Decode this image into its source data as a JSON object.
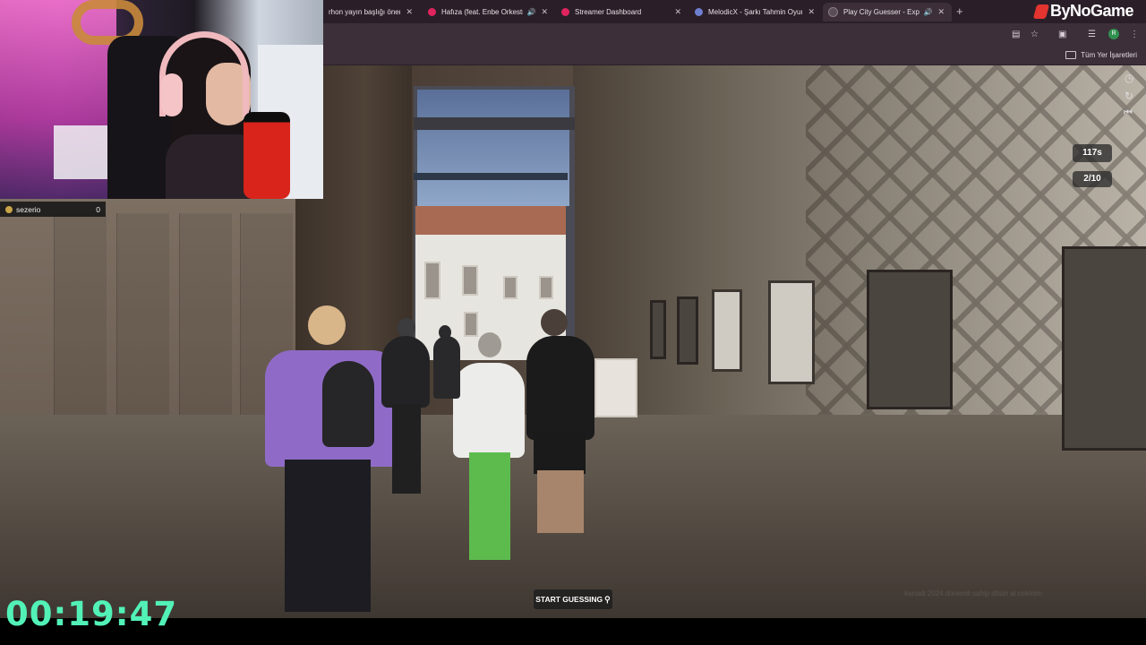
{
  "browser": {
    "tabs": [
      {
        "title": "rhon yayın başlığı öneri",
        "favicon_color": "#4a6fa5",
        "audio": false,
        "active": false
      },
      {
        "title": "Hafıza (feat. Enbe Orkestras",
        "favicon_color": "#e0245e",
        "audio": true,
        "active": false
      },
      {
        "title": "Streamer Dashboard",
        "favicon_color": "#e0245e",
        "audio": false,
        "active": false
      },
      {
        "title": "MelodicX - Şarkı Tahmin Oyunu",
        "favicon_color": "#6e7fd1",
        "audio": false,
        "active": false
      },
      {
        "title": "Play City Guesser - Explore",
        "favicon_color": "#5a4d58",
        "audio": true,
        "active": true
      }
    ],
    "new_tab": "+",
    "bookmarks_label": "Tüm Yer İşaretleri",
    "profile_initial": "R"
  },
  "game": {
    "timer_remaining": "117s",
    "round": "2/10",
    "start_button": "START GUESSING",
    "watermark": "kanadi 2024 dönemli sahip dtisin al cekinim"
  },
  "chat": {
    "username": "sezerio",
    "score": "0"
  },
  "stream": {
    "elapsed_timer": "00:19:47",
    "brand": "ByNoGame",
    "timer_color": "#52f2b7"
  }
}
